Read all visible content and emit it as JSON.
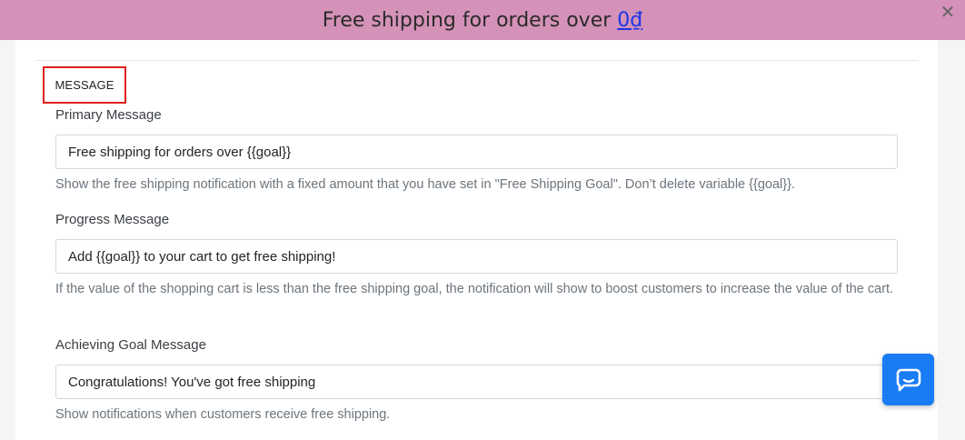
{
  "banner": {
    "text": "Free shipping for orders over",
    "amount": "0₫",
    "close_symbol": "✕"
  },
  "section": {
    "title": "MESSAGE"
  },
  "primary": {
    "label": "Primary Message",
    "value": "Free shipping for orders over {{goal}}",
    "help": "Show the free shipping notification with a fixed amount that you have set in \"Free Shipping Goal\". Don’t delete variable {{goal}}."
  },
  "progress": {
    "label": "Progress Message",
    "value": "Add {{goal}} to your cart to get free shipping!",
    "help": "If the value of the shopping cart is less than the free shipping goal, the notification will show to boost customers to increase the value of the cart."
  },
  "achieving": {
    "label": "Achieving Goal Message",
    "value": "Congratulations! You've got free shipping",
    "help": "Show notifications when customers receive free shipping."
  },
  "colors": {
    "banner_bg": "#d592b8",
    "amount_link": "#1a36e8",
    "highlight_border": "#e01e1e",
    "chat_button": "#1a7cf5"
  },
  "icons": {
    "close": "close-icon",
    "chat": "chat-bubble-icon"
  }
}
